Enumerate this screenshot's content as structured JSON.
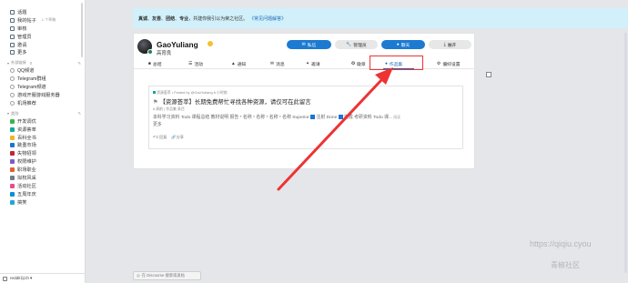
{
  "sidebar": {
    "top_items": [
      {
        "label": "话题",
        "icon": "topics-icon",
        "color": "#5b6b7a"
      },
      {
        "label": "我的帖子",
        "icon": "my-posts-icon",
        "color": "#5b6b7a",
        "badge": "1 个草稿"
      },
      {
        "label": "审核",
        "icon": "review-icon",
        "color": "#5b6b7a"
      },
      {
        "label": "管理员",
        "icon": "admin-icon",
        "color": "#5b6b7a"
      },
      {
        "label": "邀请",
        "icon": "invite-icon",
        "color": "#5b6b7a"
      },
      {
        "label": "更多",
        "icon": "more-icon",
        "color": "#5b6b7a"
      }
    ],
    "section1": {
      "title": "外部链接",
      "count": "0"
    },
    "section1_items": [
      {
        "label": "QQ频道",
        "icon": "link-icon",
        "color": "#a0a0a0"
      },
      {
        "label": "Telegram群组",
        "icon": "link-icon",
        "color": "#a0a0a0"
      },
      {
        "label": "Telegram频道",
        "icon": "link-icon",
        "color": "#a0a0a0"
      },
      {
        "label": "游戏开服游戏服务器",
        "icon": "link-icon",
        "color": "#a0a0a0"
      },
      {
        "label": "机场推荐",
        "icon": "link-icon",
        "color": "#a0a0a0"
      }
    ],
    "section2": {
      "title": "类别",
      "count": ""
    },
    "section2_items": [
      {
        "label": "开发调优",
        "color": "#3ab54a"
      },
      {
        "label": "资源荟萃",
        "color": "#12a89d"
      },
      {
        "label": "百科全书",
        "color": "#f0b429"
      },
      {
        "label": "跳蚤市场",
        "color": "#1c74d4"
      },
      {
        "label": "失物招领",
        "color": "#c5223a"
      },
      {
        "label": "权限维护",
        "color": "#7c5cc4"
      },
      {
        "label": "职场职业",
        "color": "#e45f2b"
      },
      {
        "label": "拟权风采",
        "color": "#6e7c8c"
      },
      {
        "label": "活动社区",
        "color": "#e94d8b"
      },
      {
        "label": "五周年庆",
        "color": "#0a8fd6"
      },
      {
        "label": "搞笑",
        "color": "#23a6d5"
      }
    ],
    "bottom": {
      "label": "reddit以ch",
      "caret": "▾"
    }
  },
  "banner": {
    "parts": [
      "真诚",
      "、",
      "友善",
      "、",
      "团结",
      "、",
      "专业",
      "，共建你我引以为荣之社区。"
    ],
    "link": "《常见问题解答》"
  },
  "profile": {
    "username": "GaoYuliang",
    "subname": "高育良",
    "buttons": {
      "message": "私信",
      "admin": "管理员",
      "chat": "聊天",
      "expand": "展开"
    },
    "tabs": [
      {
        "label": "总结",
        "icon": "user-icon"
      },
      {
        "label": "活动",
        "icon": "activity-icon"
      },
      {
        "label": "通知",
        "icon": "bell-icon"
      },
      {
        "label": "消息",
        "icon": "envelope-icon"
      },
      {
        "label": "邀请",
        "icon": "invite-icon"
      },
      {
        "label": "徽章",
        "icon": "badge-icon"
      },
      {
        "label": "作品集",
        "icon": "portfolio-icon"
      },
      {
        "label": "偏好设置",
        "icon": "gear-icon"
      }
    ],
    "active_tab": "作品集"
  },
  "post": {
    "meta": "资源荟萃 • Posted by @GaoYuliang 6 小时前",
    "title": "【资源荟萃】长期免费帮忙寻找各种资源，请仅可在此留言",
    "date": "6 周前 | 作品集 条目",
    "excerpt1_a": "本科学习资料 Todo 课程总结 教材说明 报告 * 名称 * 名称 * 名称 * 名称 Superior",
    "excerpt1_b": "注射 Done",
    "excerpt1_c": "完成 考研资料 Todo 课...",
    "excerpt1_tail": "阅读",
    "excerpt2": "更多",
    "actions": [
      "2 回复",
      "分享"
    ]
  },
  "composer": {
    "label": "在 Discourse 搜索或发帖"
  },
  "watermark": {
    "line1": "https://qiqiu.cyou",
    "line2": "青椒社区"
  },
  "colors": {
    "accent": "#1c7ad1",
    "annotation": "#e33333",
    "banner": "#d1f0fa"
  }
}
